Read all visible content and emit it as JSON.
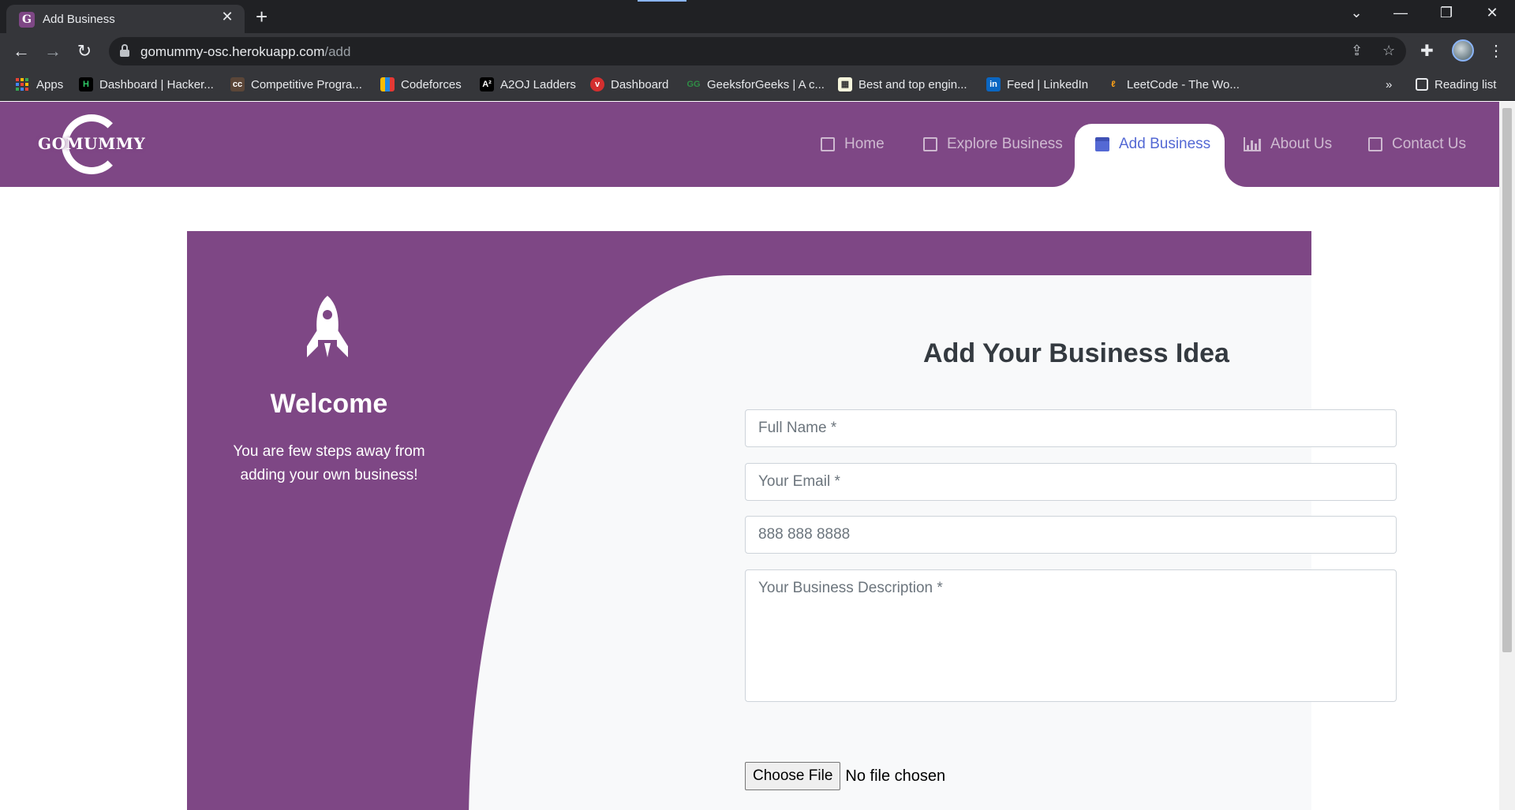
{
  "browser": {
    "tab_title": "Add Business",
    "tab_favicon_letter": "G",
    "url_host": "gomummy-osc.herokuapp.com",
    "url_path": "/add",
    "bookmarks": [
      {
        "label": "Apps",
        "icon": "apps-grid-icon"
      },
      {
        "label": "Dashboard | Hacker...",
        "icon": "hackerrank-icon"
      },
      {
        "label": "Competitive Progra...",
        "icon": "codechef-icon"
      },
      {
        "label": "Codeforces",
        "icon": "codeforces-icon"
      },
      {
        "label": "A2OJ Ladders",
        "icon": "a2oj-icon"
      },
      {
        "label": "Dashboard",
        "icon": "dashboard-icon"
      },
      {
        "label": "GeeksforGeeks | A c...",
        "icon": "gfg-icon"
      },
      {
        "label": "Best and top engin...",
        "icon": "college-icon"
      },
      {
        "label": "Feed | LinkedIn",
        "icon": "linkedin-icon"
      },
      {
        "label": "LeetCode - The Wo...",
        "icon": "leetcode-icon"
      }
    ],
    "overflow_label": "»",
    "reading_list": "Reading list"
  },
  "site": {
    "logo_text": "GOMUMMY",
    "brand_color": "#7e4785",
    "nav": [
      {
        "label": "Home",
        "icon": "contact-card-icon"
      },
      {
        "label": "Explore Business",
        "icon": "copy-icon"
      },
      {
        "label": "Add Business",
        "icon": "calendar-icon",
        "active": true
      },
      {
        "label": "About Us",
        "icon": "bar-chart-icon"
      },
      {
        "label": "Contact Us",
        "icon": "clone-icon"
      }
    ]
  },
  "welcome": {
    "title": "Welcome",
    "subtitle": "You are few steps away from adding your own business!"
  },
  "form": {
    "title": "Add Your Business Idea",
    "full_name_placeholder": "Full Name *",
    "email_placeholder": "Your Email *",
    "phone_placeholder": "888 888 8888",
    "description_placeholder": "Your Business Description *",
    "file_button": "Choose File",
    "file_status": "No file chosen"
  }
}
